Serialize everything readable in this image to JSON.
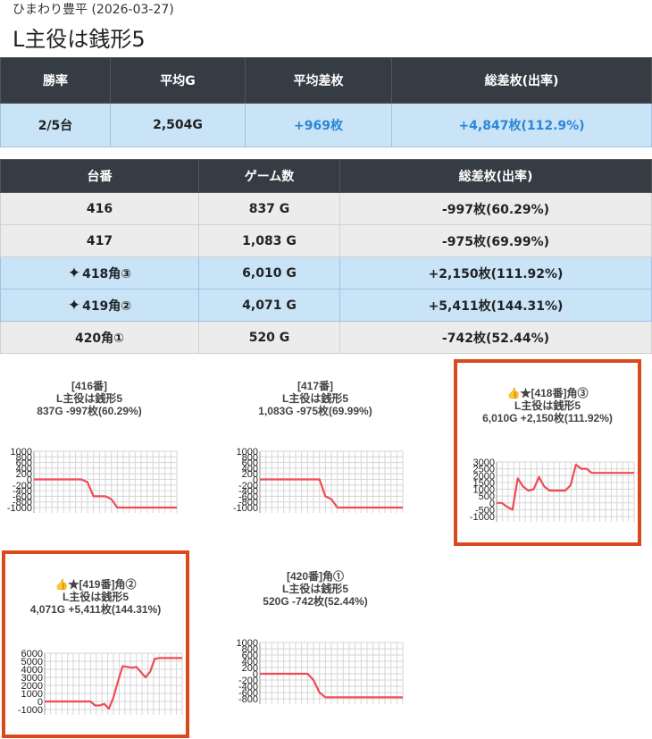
{
  "header": {
    "subtitle": "ひまわり豊平 (2026-03-27)",
    "title": "L主役は銭形5"
  },
  "summary": {
    "headers": [
      "勝率",
      "平均G",
      "平均差枚",
      "総差枚(出率)"
    ],
    "values": [
      "2/5台",
      "2,504G",
      "+969枚",
      "+4,847枚(112.9%)"
    ]
  },
  "machines": {
    "headers": [
      "台番",
      "ゲーム数",
      "総差枚(出率)"
    ],
    "rows": [
      {
        "no": "416",
        "games": "837 G",
        "diff": "-997枚(60.29%)",
        "highlight": false
      },
      {
        "no": "417",
        "games": "1,083 G",
        "diff": "-975枚(69.99%)",
        "highlight": false
      },
      {
        "no": "418角③",
        "games": "6,010 G",
        "diff": "+2,150枚(111.92%)",
        "highlight": true,
        "icon": "sparkle-icon"
      },
      {
        "no": "419角②",
        "games": "4,071 G",
        "diff": "+5,411枚(144.31%)",
        "highlight": true,
        "icon": "sparkle-icon"
      },
      {
        "no": "420角①",
        "games": "520 G",
        "diff": "-742枚(52.44%)",
        "highlight": false
      }
    ]
  },
  "colors": {
    "line": "#ef4b55",
    "highlight_border": "#d9491a",
    "header_bg": "#353c44",
    "row_highlight": "#c9e3f7"
  },
  "chart_data": [
    {
      "type": "line",
      "title_lines": [
        "[416番]",
        "L主役は銭形5",
        "837G -997枚(60.29%)"
      ],
      "yticks": [
        "1000",
        "800",
        "600",
        "400",
        "200",
        "0",
        "-200",
        "-400",
        "-600",
        "-800",
        "-1000"
      ],
      "ylim": [
        -1000,
        1000
      ],
      "x": [
        0,
        2,
        4,
        8,
        9,
        10,
        11,
        12,
        13,
        14,
        16,
        17,
        18,
        20,
        24
      ],
      "y": [
        0,
        0,
        0,
        0,
        -100,
        -600,
        -600,
        -600,
        -700,
        -1000,
        -1000,
        -1000,
        -1000,
        -1000,
        -1000
      ],
      "xlim": [
        0,
        24
      ]
    },
    {
      "type": "line",
      "title_lines": [
        "[417番]",
        "L主役は銭形5",
        "1,083G -975枚(69.99%)"
      ],
      "yticks": [
        "1000",
        "800",
        "600",
        "400",
        "200",
        "0",
        "-200",
        "-400",
        "-600",
        "-800",
        "-1000"
      ],
      "ylim": [
        -1000,
        1000
      ],
      "x": [
        0,
        2,
        4,
        6,
        8,
        10,
        11,
        12,
        13,
        14,
        16,
        18,
        20,
        24
      ],
      "y": [
        0,
        0,
        0,
        0,
        0,
        0,
        -600,
        -700,
        -1000,
        -1000,
        -1000,
        -1000,
        -1000,
        -1000
      ],
      "xlim": [
        0,
        24
      ]
    },
    {
      "type": "line",
      "title_lines": [
        "👍★[418番]角③",
        "L主役は銭形5",
        "6,010G +2,150枚(111.92%)"
      ],
      "yticks": [
        "3000",
        "2500",
        "2000",
        "1500",
        "1000",
        "500",
        "0",
        "-500",
        "-1000"
      ],
      "ylim": [
        -1000,
        3000
      ],
      "x": [
        0,
        1,
        2,
        3,
        4,
        5,
        6,
        7,
        8,
        9,
        10,
        11,
        12,
        13,
        14,
        15,
        16,
        17,
        18,
        19,
        20,
        21,
        22,
        23,
        24,
        25,
        26
      ],
      "y": [
        0,
        0,
        -300,
        -500,
        1800,
        1200,
        900,
        1000,
        1900,
        1200,
        900,
        900,
        900,
        900,
        1300,
        2800,
        2500,
        2500,
        2200,
        2200,
        2200,
        2200,
        2200,
        2200,
        2200,
        2200,
        2200
      ],
      "xlim": [
        0,
        26
      ]
    },
    {
      "type": "line",
      "title_lines": [
        "👍★[419番]角②",
        "L主役は銭形5",
        "4,071G +5,411枚(144.31%)"
      ],
      "yticks": [
        "6000",
        "5000",
        "4000",
        "3000",
        "2000",
        "1000",
        "0",
        "-1000"
      ],
      "ylim": [
        -1000,
        6000
      ],
      "x": [
        0,
        2,
        4,
        6,
        8,
        10,
        11,
        12,
        13,
        14,
        15,
        16,
        17,
        18,
        19,
        20,
        22,
        23,
        24,
        25,
        26,
        28,
        30
      ],
      "y": [
        0,
        0,
        0,
        0,
        0,
        0,
        -500,
        -500,
        -300,
        -900,
        500,
        2500,
        4400,
        4300,
        4200,
        4300,
        3000,
        3700,
        5300,
        5400,
        5400,
        5400,
        5400
      ],
      "xlim": [
        0,
        30
      ]
    },
    {
      "type": "line",
      "title_lines": [
        "[420番]角①",
        "L主役は銭形5",
        "520G -742枚(52.44%)"
      ],
      "yticks": [
        "1000",
        "800",
        "600",
        "400",
        "200",
        "0",
        "-200",
        "-400",
        "-600",
        "-800"
      ],
      "ylim": [
        -800,
        1000
      ],
      "x": [
        0,
        2,
        4,
        6,
        8,
        9,
        10,
        11,
        12,
        14,
        16,
        18,
        20,
        22,
        24
      ],
      "y": [
        0,
        0,
        0,
        0,
        0,
        -200,
        -600,
        -750,
        -750,
        -750,
        -750,
        -750,
        -750,
        -750,
        -750
      ],
      "xlim": [
        0,
        24
      ]
    }
  ]
}
